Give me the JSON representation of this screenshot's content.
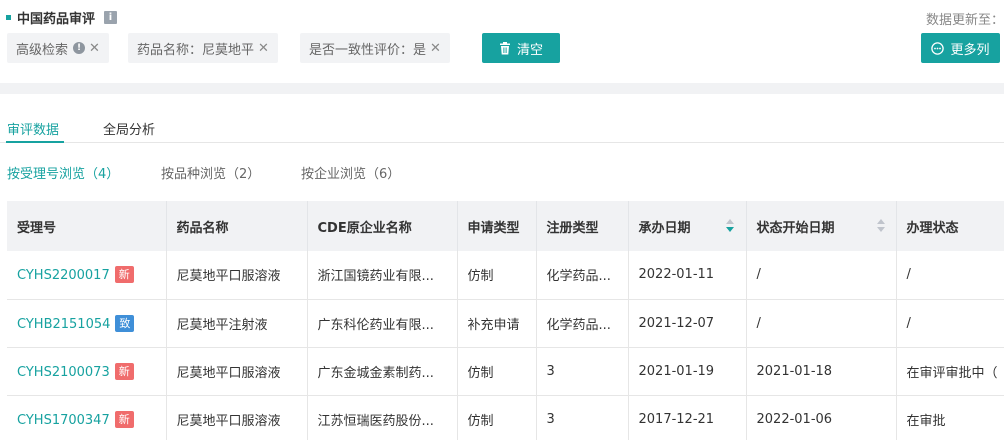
{
  "header": {
    "title": "中国药品审评",
    "info_icon": "i",
    "update_text": "数据更新至："
  },
  "filters": [
    {
      "label": "高级检索",
      "has_help": true,
      "help_icon": "!",
      "close": "✕"
    },
    {
      "label": "药品名称：尼莫地平",
      "has_help": false,
      "close": "✕"
    },
    {
      "label": "是否一致性评价：是",
      "has_help": false,
      "close": "✕"
    }
  ],
  "buttons": {
    "clear_label": "清空",
    "more_label": "更多列"
  },
  "tabs": [
    {
      "label": "审评数据",
      "active": true
    },
    {
      "label": "全局分析",
      "active": false
    }
  ],
  "subtabs": [
    {
      "label": "按受理号浏览（4）",
      "active": true
    },
    {
      "label": "按品种浏览（2）",
      "active": false
    },
    {
      "label": "按企业浏览（6）",
      "active": false
    }
  ],
  "table": {
    "columns": [
      "受理号",
      "药品名称",
      "CDE原企业名称",
      "申请类型",
      "注册类型",
      "承办日期",
      "状态开始日期",
      "办理状态"
    ],
    "rows": [
      {
        "id": "CYHS2200017",
        "badge": "新",
        "badge_color": "#f06c6c",
        "drug": "尼莫地平口服溶液",
        "company": "浙江国镜药业有限...",
        "app_type": "仿制",
        "reg_type": "化学药品...",
        "date": "2022-01-11",
        "status_date": "/",
        "status": "/"
      },
      {
        "id": "CYHB2151054",
        "badge": "致",
        "badge_color": "#3f8fd8",
        "drug": "尼莫地平注射液",
        "company": "广东科伦药业有限...",
        "app_type": "补充申请",
        "reg_type": "化学药品...",
        "date": "2021-12-07",
        "status_date": "/",
        "status": "/"
      },
      {
        "id": "CYHS2100073",
        "badge": "新",
        "badge_color": "#f06c6c",
        "drug": "尼莫地平口服溶液",
        "company": "广东金城金素制药...",
        "app_type": "仿制",
        "reg_type": "3",
        "date": "2021-01-19",
        "status_date": "2021-01-18",
        "status": "在审评审批中（"
      },
      {
        "id": "CYHS1700347",
        "badge": "新",
        "badge_color": "#f06c6c",
        "drug": "尼莫地平口服溶液",
        "company": "江苏恒瑞医药股份...",
        "app_type": "仿制",
        "reg_type": "3",
        "date": "2017-12-21",
        "status_date": "2022-01-06",
        "status": "在审批"
      }
    ]
  },
  "colors": {
    "accent": "#17a2a0",
    "badge_new": "#f06c6c",
    "badge_consistency": "#3f8fd8"
  }
}
